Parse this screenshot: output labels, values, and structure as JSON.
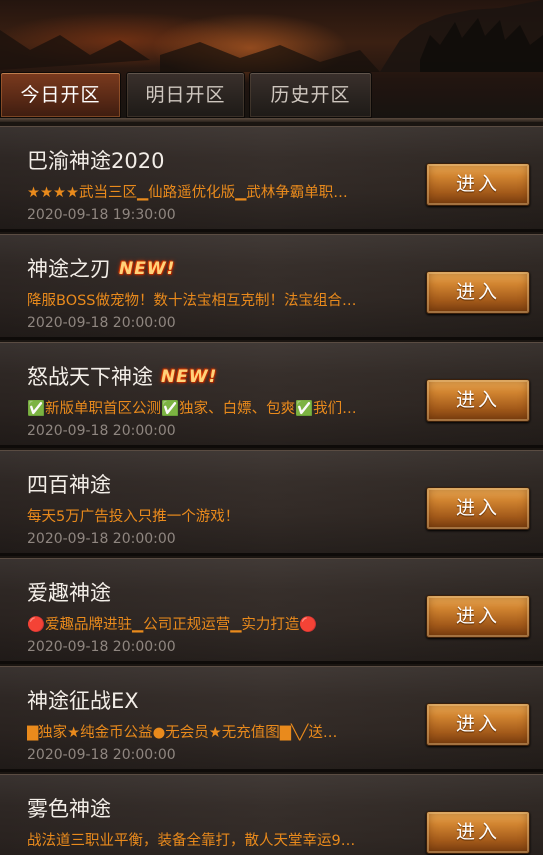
{
  "tabs": [
    {
      "label": "今日开区",
      "active": true
    },
    {
      "label": "明日开区",
      "active": false
    },
    {
      "label": "历史开区",
      "active": false
    }
  ],
  "new_badge": "NEW!",
  "enter_label": "进入",
  "servers": [
    {
      "title": "巴渝神途2020",
      "is_new": false,
      "desc": "★★★★武当三区▁仙路遥优化版▁武林争霸单职…",
      "time": "2020-09-18 19:30:00"
    },
    {
      "title": "神途之刃",
      "is_new": true,
      "desc": "降服BOSS做宠物！数十法宝相互克制！法宝组合…",
      "time": "2020-09-18 20:00:00"
    },
    {
      "title": "怒战天下神途",
      "is_new": true,
      "desc": "✅新版单职首区公测✅独家、白嫖、包爽✅我们…",
      "time": "2020-09-18 20:00:00"
    },
    {
      "title": "四百神途",
      "is_new": false,
      "desc": "每天5万广告投入只推一个游戏！",
      "time": "2020-09-18 20:00:00"
    },
    {
      "title": "爱趣神途",
      "is_new": false,
      "desc": "🔴爱趣品牌进驻▁公司正规运营▁实力打造🔴",
      "time": "2020-09-18 20:00:00"
    },
    {
      "title": "神途征战EX",
      "is_new": false,
      "desc": "▇独家★纯金币公益●无会员★无充值图▇╲╱送…",
      "time": "2020-09-18 20:00:00"
    },
    {
      "title": "雾色神途",
      "is_new": false,
      "desc": "战法道三职业平衡，装备全靠打，散人天堂幸运9…",
      "time": ""
    }
  ],
  "colors": {
    "desc_orange": "#e98a1c",
    "time_gray": "#8f8680",
    "active_tab": "#5b2a16",
    "button_gold": "#d18430"
  }
}
